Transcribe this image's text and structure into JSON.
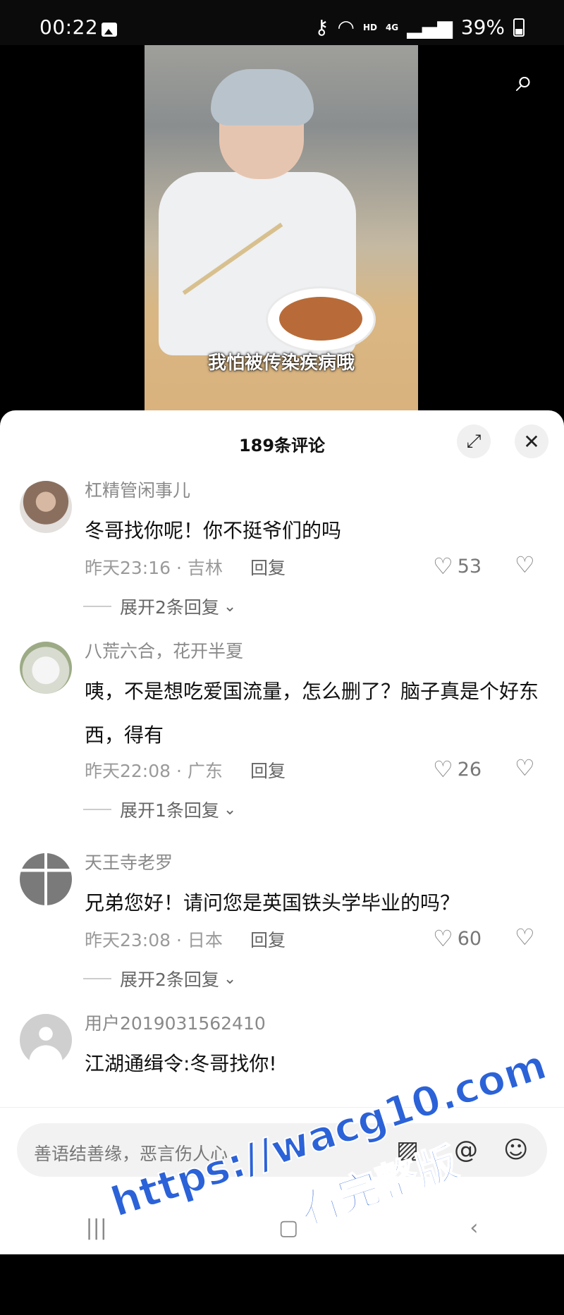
{
  "status_bar": {
    "time": "00:22",
    "network": "HD",
    "signal": "4G",
    "battery": "39%"
  },
  "video": {
    "caption": "我怕被传染疾病哦"
  },
  "comments_panel": {
    "title": "189条评论",
    "comments": [
      {
        "username": "杠精管闲事儿",
        "text": "冬哥找你呢！你不挺爷们的吗",
        "time": "昨天23:16 · 吉林",
        "reply": "回复",
        "likes": "53",
        "expand": "展开2条回复"
      },
      {
        "username": "八荒六合，花开半夏",
        "text": "咦，不是想吃爱国流量，怎么删了？脑子真是个好东西，得有",
        "time": "昨天22:08 · 广东",
        "reply": "回复",
        "likes": "26",
        "expand": "展开1条回复"
      },
      {
        "username": "天王寺老罗",
        "text": "兄弟您好！请问您是英国铁头学毕业的吗？",
        "time": "昨天23:08 · 日本",
        "reply": "回复",
        "likes": "60",
        "expand": "展开2条回复"
      },
      {
        "username": "用户2019031562410",
        "text": "江湖通缉令:冬哥找你!"
      }
    ]
  },
  "input": {
    "placeholder": "善语结善缘，恶言伤人心"
  },
  "watermark": {
    "line1": "https://wacg10.com",
    "line2": "看完整版"
  },
  "icons": [
    "search-icon",
    "expand-icon",
    "close-icon",
    "heart-icon",
    "broken-heart-icon",
    "image-icon",
    "at-icon",
    "emoji-icon",
    "recent-apps-icon",
    "home-icon",
    "back-icon"
  ]
}
